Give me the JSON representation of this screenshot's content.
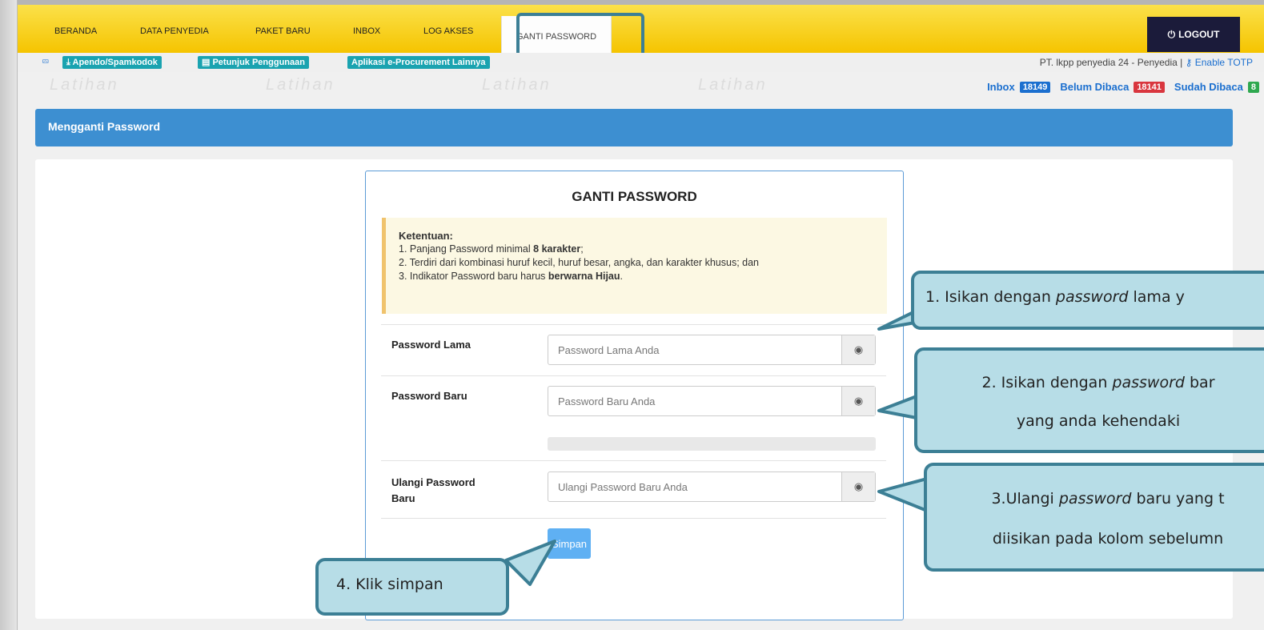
{
  "nav": {
    "items": [
      "BERANDA",
      "DATA PENYEDIA",
      "PAKET BARU",
      "INBOX",
      "LOG AKSES"
    ],
    "active": "GANTI PASSWORD",
    "logout": "LOGOUT"
  },
  "subbar": {
    "chip_apendo": "Apendo/Spamkodok",
    "chip_petunjuk": "Petunjuk Penggunaan",
    "chip_aplikasi": "Aplikasi e-Procurement Lainnya",
    "user": "PT. lkpp penyedia 24 - Penyedia |",
    "totp": "Enable TOTP"
  },
  "watermark": "Latihan",
  "inbox": {
    "inbox_label": "Inbox",
    "inbox_count": "18149",
    "unread_label": "Belum Dibaca",
    "unread_count": "18141",
    "read_label": "Sudah Dibaca",
    "read_count": "8"
  },
  "panel": {
    "title": "Mengganti Password"
  },
  "form": {
    "title": "GANTI PASSWORD",
    "notice_title": "Ketentuan:",
    "rule1_a": "1. Panjang Password minimal ",
    "rule1_b": "8 karakter",
    "rule1_c": ";",
    "rule2": "2. Terdiri dari kombinasi huruf kecil, huruf besar, angka, dan karakter khusus; dan",
    "rule3_a": "3. Indikator Password baru harus ",
    "rule3_b": "berwarna Hijau",
    "rule3_c": ".",
    "old_label": "Password Lama",
    "old_placeholder": "Password Lama Anda",
    "new_label": "Password Baru",
    "new_placeholder": "Password Baru Anda",
    "repeat_label_1": "Ulangi Password",
    "repeat_label_2": "Baru",
    "repeat_placeholder": "Ulangi Password Baru Anda",
    "save": "Simpan"
  },
  "callouts": {
    "c1_a": "1. Isikan dengan ",
    "c1_b": "password",
    "c1_c": " lama y",
    "c2_a": "2. Isikan dengan ",
    "c2_b": "password",
    "c2_c": " bar",
    "c2_line2": "yang anda kehendaki",
    "c3_a": "3.Ulangi ",
    "c3_b": "password",
    "c3_c": " baru yang t",
    "c3_line2": "diisikan pada kolom sebelumn",
    "c4": "4. Klik simpan"
  },
  "colors": {
    "nav_yellow": "#f5c400",
    "panel_blue": "#3d8fd1",
    "chip_teal": "#1aa3b0",
    "badge_blue": "#1b6fcf",
    "badge_red": "#d9363e",
    "badge_green": "#2fa84f",
    "callout_fill": "#b7dde7",
    "callout_border": "#3c7f95"
  }
}
